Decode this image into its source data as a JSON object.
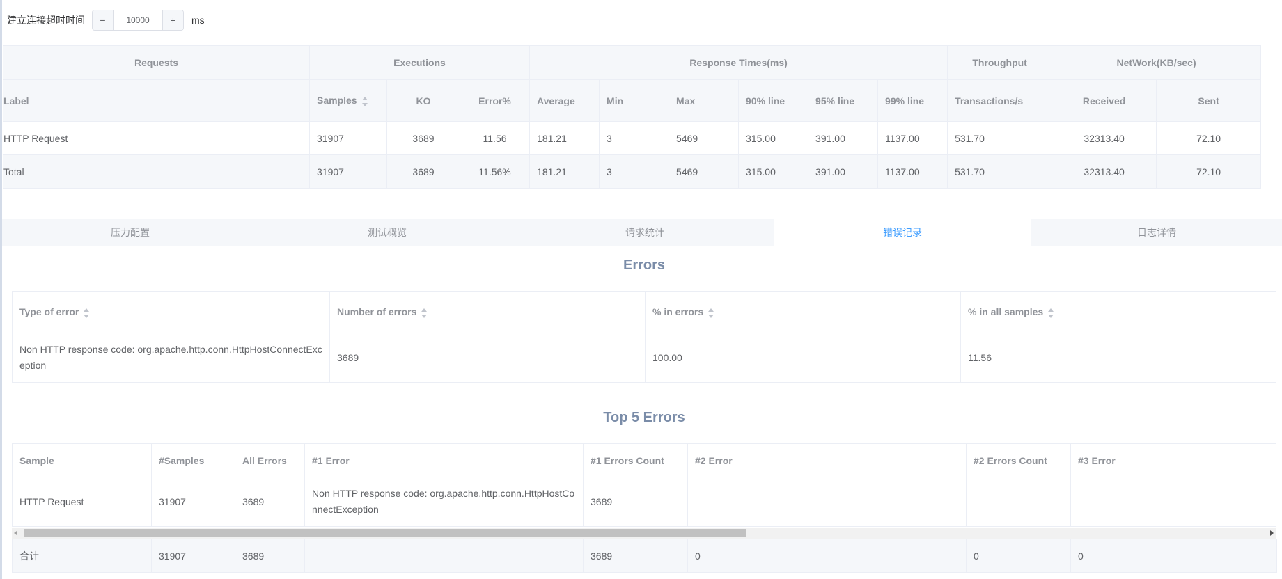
{
  "timeout": {
    "label": "建立连接超时时间",
    "minus": "−",
    "plus": "+",
    "value": "10000",
    "unit": "ms"
  },
  "stats": {
    "groups": [
      "Requests",
      "Executions",
      "Response Times(ms)",
      "Throughput",
      "NetWork(KB/sec)"
    ],
    "columns": [
      "Label",
      "Samples",
      "KO",
      "Error%",
      "Average",
      "Min",
      "Max",
      "90% line",
      "95% line",
      "99% line",
      "Transactions/s",
      "Received",
      "Sent"
    ],
    "rows": [
      [
        "HTTP Request",
        "31907",
        "3689",
        "11.56",
        "181.21",
        "3",
        "5469",
        "315.00",
        "391.00",
        "1137.00",
        "531.70",
        "32313.40",
        "72.10"
      ],
      [
        "Total",
        "31907",
        "3689",
        "11.56%",
        "181.21",
        "3",
        "5469",
        "315.00",
        "391.00",
        "1137.00",
        "531.70",
        "32313.40",
        "72.10"
      ]
    ]
  },
  "tabs": [
    {
      "label": "压力配置",
      "active": false
    },
    {
      "label": "测试概览",
      "active": false
    },
    {
      "label": "请求统计",
      "active": false
    },
    {
      "label": "错误记录",
      "active": true
    },
    {
      "label": "日志详情",
      "active": false
    }
  ],
  "errors": {
    "title": "Errors",
    "columns": [
      "Type of error",
      "Number of errors",
      "% in errors",
      "% in all samples"
    ],
    "rows": [
      [
        "Non HTTP response code: org.apache.http.conn.HttpHostConnectException",
        "3689",
        "100.00",
        "11.56"
      ]
    ]
  },
  "top5": {
    "title": "Top 5 Errors",
    "columns": [
      "Sample",
      "#Samples",
      "All Errors",
      "#1 Error",
      "#1 Errors Count",
      "#2 Error",
      "#2 Errors Count",
      "#3 Error"
    ],
    "rows": [
      [
        "HTTP Request",
        "31907",
        "3689",
        "Non HTTP response code: org.apache.http.conn.HttpHostConnectException",
        "3689",
        "",
        "",
        ""
      ]
    ],
    "summary": [
      "合计",
      "31907",
      "3689",
      "",
      "3689",
      "0",
      "0",
      "0"
    ]
  }
}
